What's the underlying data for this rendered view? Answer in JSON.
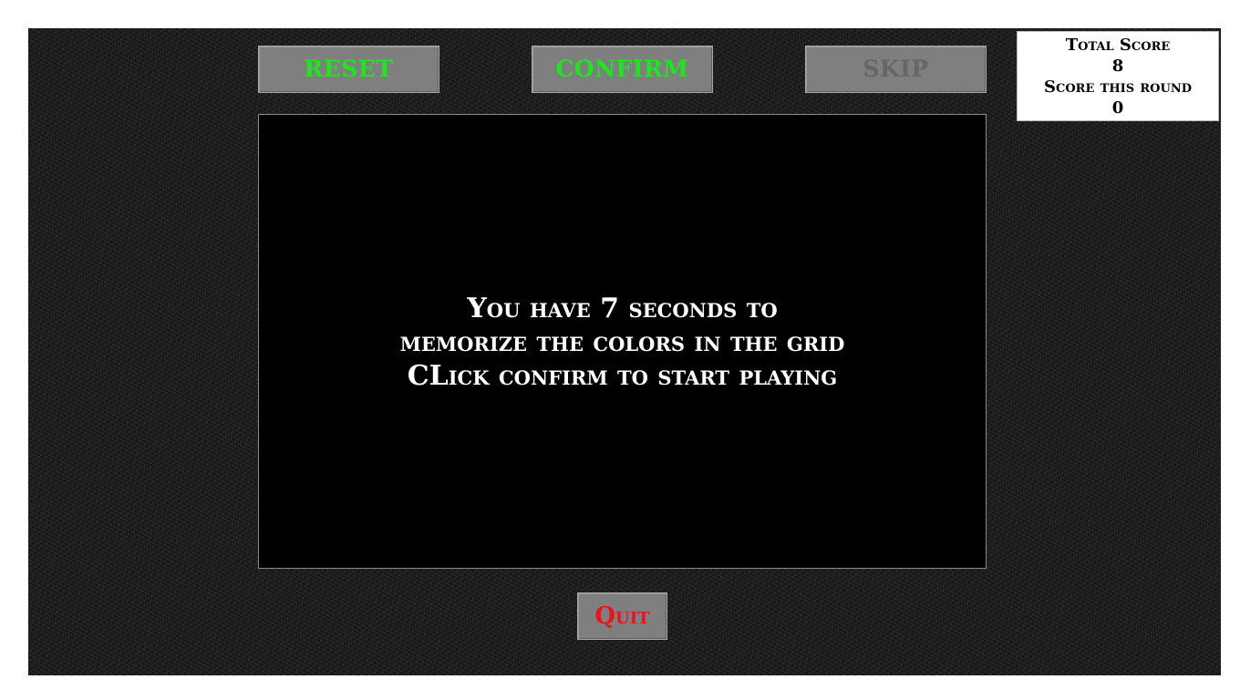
{
  "toolbar": {
    "reset_label": "RESET",
    "confirm_label": "CONFIRM",
    "skip_label": "SKIP"
  },
  "score_panel": {
    "total_score_label": "Total Score",
    "total_score_value": "8",
    "round_score_label": "Score this round",
    "round_score_value": "0"
  },
  "grid": {
    "message_lines": [
      "You have 7 seconds to",
      "memorize the colors in the grid",
      "CLick confirm to start playing"
    ]
  },
  "footer": {
    "quit_label": "Quit"
  },
  "colors": {
    "active_button_text": "#1ee61e",
    "disabled_button_text": "#666666",
    "quit_text": "#e8141c",
    "button_background": "#7f7f7f",
    "grid_background": "#000000"
  }
}
